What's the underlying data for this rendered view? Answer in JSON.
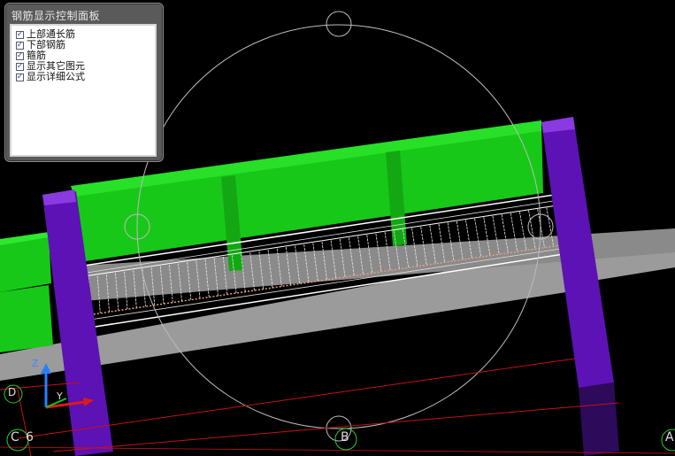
{
  "panel": {
    "title": "钢筋显示控制面板",
    "options": [
      {
        "label": "上部通长筋",
        "checked": true
      },
      {
        "label": "下部钢筋",
        "checked": true
      },
      {
        "label": "箍筋",
        "checked": true
      },
      {
        "label": "显示其它图元",
        "checked": true
      },
      {
        "label": "显示详细公式",
        "checked": true
      }
    ]
  },
  "grid_labels": {
    "left_bottom": "C",
    "left_num": "6",
    "center": "B",
    "right": "A",
    "left_top": "D"
  },
  "triad": {
    "z": "Z",
    "y": "Y"
  },
  "colors": {
    "background": "#000000",
    "beam_green": "#19d419",
    "column_purple": "#6a1ac0",
    "slab_gray": "#9a9a9a",
    "grid_red": "#d41414"
  }
}
